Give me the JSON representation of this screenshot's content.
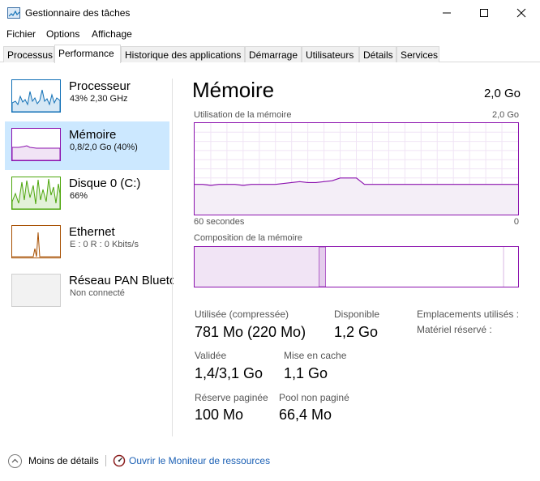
{
  "window": {
    "title": "Gestionnaire des tâches"
  },
  "menu": {
    "items": [
      "Fichier",
      "Options",
      "Affichage"
    ]
  },
  "tabs": [
    {
      "label": "Processus",
      "active": false
    },
    {
      "label": "Performance",
      "active": true
    },
    {
      "label": "Historique des applications",
      "active": false
    },
    {
      "label": "Démarrage",
      "active": false
    },
    {
      "label": "Utilisateurs",
      "active": false
    },
    {
      "label": "Détails",
      "active": false
    },
    {
      "label": "Services",
      "active": false
    }
  ],
  "sidebar": {
    "items": [
      {
        "title": "Processeur",
        "subtitle": "43% 2,30 GHz",
        "color": "#1170b6",
        "selected": false
      },
      {
        "title": "Mémoire",
        "subtitle": "0,8/2,0 Go (40%)",
        "color": "#8b12ae",
        "selected": true
      },
      {
        "title": "Disque 0 (C:)",
        "subtitle": "66%",
        "color": "#4da60c",
        "selected": false
      },
      {
        "title": "Ethernet",
        "subtitle": "E : 0 R : 0 Kbits/s",
        "color": "#a74f01",
        "selected": false
      },
      {
        "title": "Réseau PAN Bluetooth",
        "subtitle": "Non connecté",
        "color": "#a0a0a0",
        "selected": false
      }
    ]
  },
  "main": {
    "title": "Mémoire",
    "total": "2,0 Go",
    "usage_label": "Utilisation de la mémoire",
    "usage_max": "2,0 Go",
    "time_left": "60 secondes",
    "time_right": "0",
    "composition_label": "Composition de la mémoire",
    "stats": {
      "used_label": "Utilisée (compressée)",
      "used_value": "781 Mo (220 Mo)",
      "available_label": "Disponible",
      "available_value": "1,2 Go",
      "slots_label": "Emplacements utilisés :",
      "hw_reserved_label": "Matériel réservé :",
      "committed_label": "Validée",
      "committed_value": "1,4/3,1 Go",
      "cached_label": "Mise en cache",
      "cached_value": "1,1 Go",
      "paged_label": "Réserve paginée",
      "paged_value": "100 Mo",
      "nonpaged_label": "Pool non paginé",
      "nonpaged_value": "66,4 Mo"
    },
    "usage_series_percent": [
      33,
      33,
      32,
      33,
      33,
      33,
      32,
      33,
      33,
      33,
      33,
      34,
      35,
      36,
      35,
      35,
      36,
      37,
      40,
      40,
      40,
      33,
      33,
      33,
      33,
      33,
      33,
      33,
      33,
      33,
      33,
      33,
      33,
      33,
      33,
      33,
      33,
      33,
      33,
      33,
      33
    ],
    "composition_in_use_fraction": 0.385,
    "composition_modified_fraction": 0.02,
    "composition_standby_fraction": 0.55
  },
  "footer": {
    "less_details": "Moins de détails",
    "open_monitor": "Ouvrir le Moniteur de ressources"
  }
}
